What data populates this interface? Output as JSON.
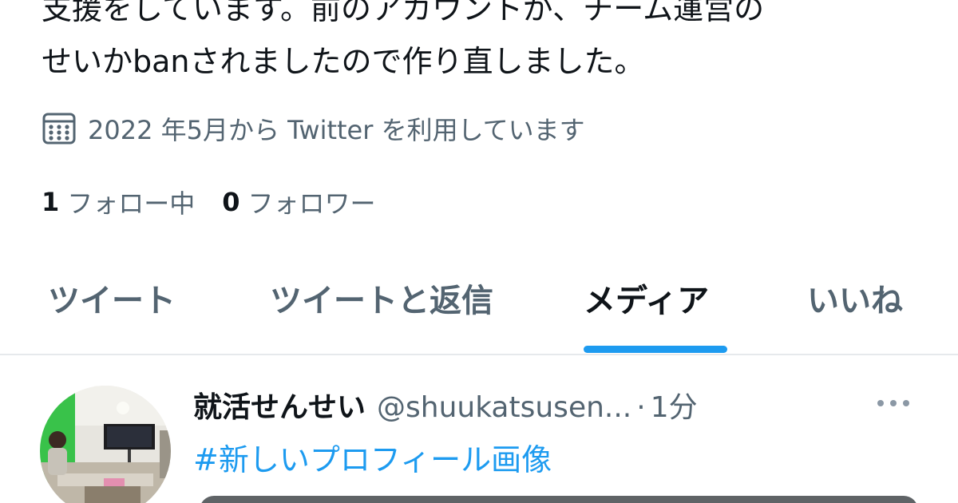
{
  "profile": {
    "bio_lines": [
      "支援をしています。前のアカウントが、チーム運営の",
      "せいかbanされましたので作り直しました。"
    ],
    "joined_text": "2022 年5月から Twitter を利用しています",
    "following_count": "1",
    "following_label": "フォロー中",
    "followers_count": "0",
    "followers_label": "フォロワー"
  },
  "tabs": [
    {
      "label": "ツイート",
      "active": false
    },
    {
      "label": "ツイートと返信",
      "active": false
    },
    {
      "label": "メディア",
      "active": true
    },
    {
      "label": "いいね",
      "active": false
    }
  ],
  "tweet": {
    "name": "就活せんせい",
    "handle": "@shuukatsusen...",
    "separator": "·",
    "time": "1分",
    "text": "#新しいプロフィール画像"
  },
  "icons": {
    "calendar": "calendar-icon",
    "more": "more-horizontal-icon"
  },
  "colors": {
    "accent": "#1d9bf0",
    "text_primary": "#0f1419",
    "text_secondary": "#536471",
    "divider": "#e6e9ec"
  }
}
